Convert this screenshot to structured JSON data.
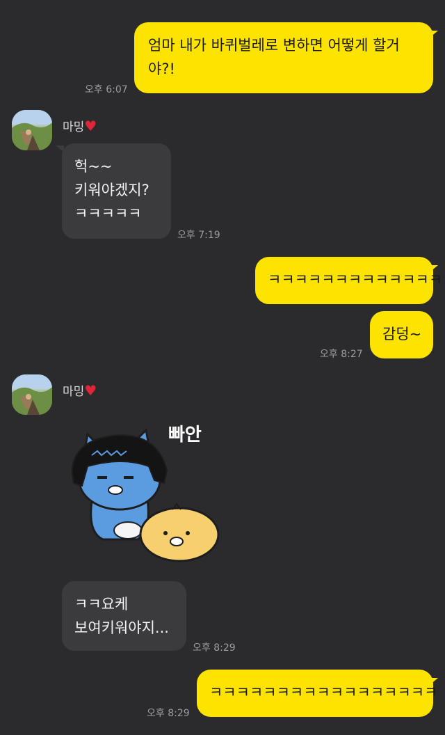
{
  "messages": [
    {
      "id": "m1",
      "lines": [
        "엄마 내가 바퀴벌레로 변하면 어떻게 할거",
        "야?!"
      ],
      "time": "오후 6:07"
    },
    {
      "id": "m2",
      "sender": "마밍",
      "lines": [
        "헉~~",
        "키워야겠지?",
        "ㅋㅋㅋㅋㅋ"
      ],
      "time": "오후 7:19"
    },
    {
      "id": "m3",
      "lines": [
        "ㅋㅋㅋㅋㅋㅋㅋㅋㅋㅋㅋㅋㅋ"
      ]
    },
    {
      "id": "m4",
      "lines": [
        "감덩~"
      ],
      "time": "오후 8:27"
    },
    {
      "id": "m5",
      "sender": "마밍",
      "sticker_text": "빠안"
    },
    {
      "id": "m6",
      "lines": [
        "ㅋㅋ요케",
        "보여키워야지..."
      ],
      "time": "오후 8:29"
    },
    {
      "id": "m7",
      "lines": [
        "ㅋㅋㅋㅋㅋㅋㅋㅋㅋㅋㅋㅋㅋㅋㅋㅋㅋ"
      ],
      "time": "오후 8:29"
    }
  ],
  "icons": {
    "heart": "heart-icon"
  },
  "colors": {
    "outgoing_bubble": "#fde400",
    "incoming_bubble": "#3b3b3e",
    "background": "#2b2b2d"
  }
}
